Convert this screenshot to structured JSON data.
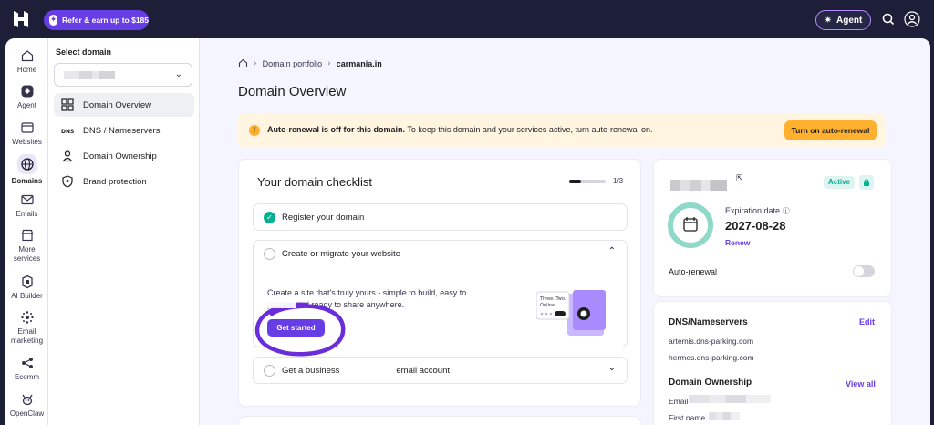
{
  "topbar": {
    "refer_label": "Refer & earn up to $185",
    "agent_label": "Agent"
  },
  "rail": [
    {
      "label": "Home",
      "icon": "home-icon"
    },
    {
      "label": "Agent",
      "icon": "agent-icon"
    },
    {
      "label": "Websites",
      "icon": "websites-icon"
    },
    {
      "label": "Domains",
      "icon": "globe-icon",
      "active": true
    },
    {
      "label": "Emails",
      "icon": "mail-icon"
    },
    {
      "label": "More services",
      "icon": "store-icon"
    },
    {
      "label": "AI Builder",
      "icon": "ai-builder-icon"
    },
    {
      "label": "Email marketing",
      "icon": "email-marketing-icon"
    },
    {
      "label": "Ecomm",
      "icon": "ecomm-icon"
    },
    {
      "label": "OpenClaw",
      "icon": "openclaw-icon"
    }
  ],
  "domain_sidebar": {
    "select_label": "Select domain",
    "items": [
      {
        "label": "Domain Overview",
        "active": true
      },
      {
        "label": "DNS / Nameservers"
      },
      {
        "label": "Domain Ownership"
      },
      {
        "label": "Brand protection"
      }
    ]
  },
  "breadcrumb": {
    "parent": "Domain portfolio",
    "current": "carmania.in"
  },
  "page_title": "Domain Overview",
  "alert": {
    "bold": "Auto-renewal is off for this domain.",
    "text": " To keep this domain and your services active, turn auto-renewal on.",
    "button": "Turn on auto-renewal",
    "color": "#ffb02e"
  },
  "checklist": {
    "title": "Your domain checklist",
    "progress_text": "1/3",
    "progress_fraction": 0.33,
    "steps": {
      "register": {
        "label": "Register your domain",
        "done": true
      },
      "website": {
        "label": "Create or migrate your website",
        "description": "Create a site that's truly yours - simple to build, easy to publish and ready to share anywhere.",
        "button": "Get started"
      },
      "email": {
        "label_start": "Get a business",
        "label_end": "email account"
      }
    }
  },
  "domain_card": {
    "status": "Active",
    "expiration_label": "Expiration date",
    "expiration_date": "2027-08-28",
    "renew": "Renew",
    "auto_renewal_label": "Auto-renewal",
    "auto_renewal_on": false
  },
  "dns": {
    "title": "DNS/Nameservers",
    "edit": "Edit",
    "nameservers": [
      "artemis.dns-parking.com",
      "hermes.dns-parking.com"
    ]
  },
  "ownership": {
    "title": "Domain Ownership",
    "view_all": "View all",
    "email_label": "Email",
    "first_name_label": "First name"
  },
  "colors": {
    "brand": "#673de6",
    "success": "#00b090",
    "warning": "#ffb02e",
    "annotation": "#6a2dd9"
  }
}
